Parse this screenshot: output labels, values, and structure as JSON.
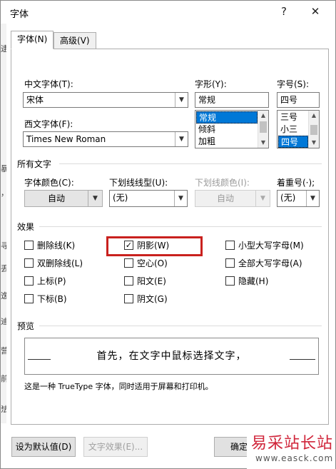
{
  "window": {
    "title": "字体",
    "help": "?",
    "close": "✕"
  },
  "left_strip": [
    "逮",
    "暴",
    "，",
    "寻",
    "丢",
    "逸",
    "迪",
    "营",
    "前",
    "，",
    "法"
  ],
  "tabs": [
    {
      "label": "字体(N)",
      "active": true
    },
    {
      "label": "高级(V)",
      "active": false
    }
  ],
  "fonts": {
    "chinese_label": "中文字体(T):",
    "chinese_value": "宋体",
    "western_label": "西文字体(F):",
    "western_value": "Times New Roman",
    "style_label": "字形(Y):",
    "style_value": "常规",
    "style_options": [
      "常规",
      "倾斜",
      "加粗"
    ],
    "style_selected": "常规",
    "size_label": "字号(S):",
    "size_value": "四号",
    "size_options": [
      "三号",
      "小三",
      "四号"
    ],
    "size_selected": "四号"
  },
  "all_text": {
    "section_label": "所有文字",
    "color_label": "字体颜色(C):",
    "color_value": "自动",
    "underline_label": "下划线线型(U):",
    "underline_value": "(无)",
    "underline_color_label": "下划线颜色(I):",
    "underline_color_value": "自动",
    "emphasis_label": "着重号(·);",
    "emphasis_value": "(无)"
  },
  "effects": {
    "section_label": "效果",
    "strikethrough": {
      "label": "删除线(K)",
      "checked": false
    },
    "shadow": {
      "label": "阴影(W)",
      "checked": true
    },
    "small_caps": {
      "label": "小型大写字母(M)",
      "checked": false
    },
    "double_strikethrough": {
      "label": "双删除线(L)",
      "checked": false
    },
    "outline": {
      "label": "空心(O)",
      "checked": false
    },
    "all_caps": {
      "label": "全部大写字母(A)",
      "checked": false
    },
    "superscript": {
      "label": "上标(P)",
      "checked": false
    },
    "emboss": {
      "label": "阳文(E)",
      "checked": false
    },
    "hidden": {
      "label": "隐藏(H)",
      "checked": false
    },
    "subscript": {
      "label": "下标(B)",
      "checked": false
    },
    "engrave": {
      "label": "阴文(G)",
      "checked": false
    },
    "highlight_color": "#c9211e"
  },
  "preview": {
    "section_label": "预览",
    "sample_text": "首先，在文字中鼠标选择文字，",
    "note": "这是一种 TrueType 字体，同时适用于屏幕和打印机。"
  },
  "buttons": {
    "set_default": "设为默认值(D)",
    "text_effects": "文字效果(E)...",
    "ok": "确定"
  },
  "watermark": {
    "title": "易采站长站",
    "url": "www.easck.com"
  },
  "colors": {
    "selection": "#0078d7",
    "watermark": "#d0253a"
  },
  "icons": {
    "dropdown": "chevron-down-icon",
    "check": "checkmark-icon"
  }
}
